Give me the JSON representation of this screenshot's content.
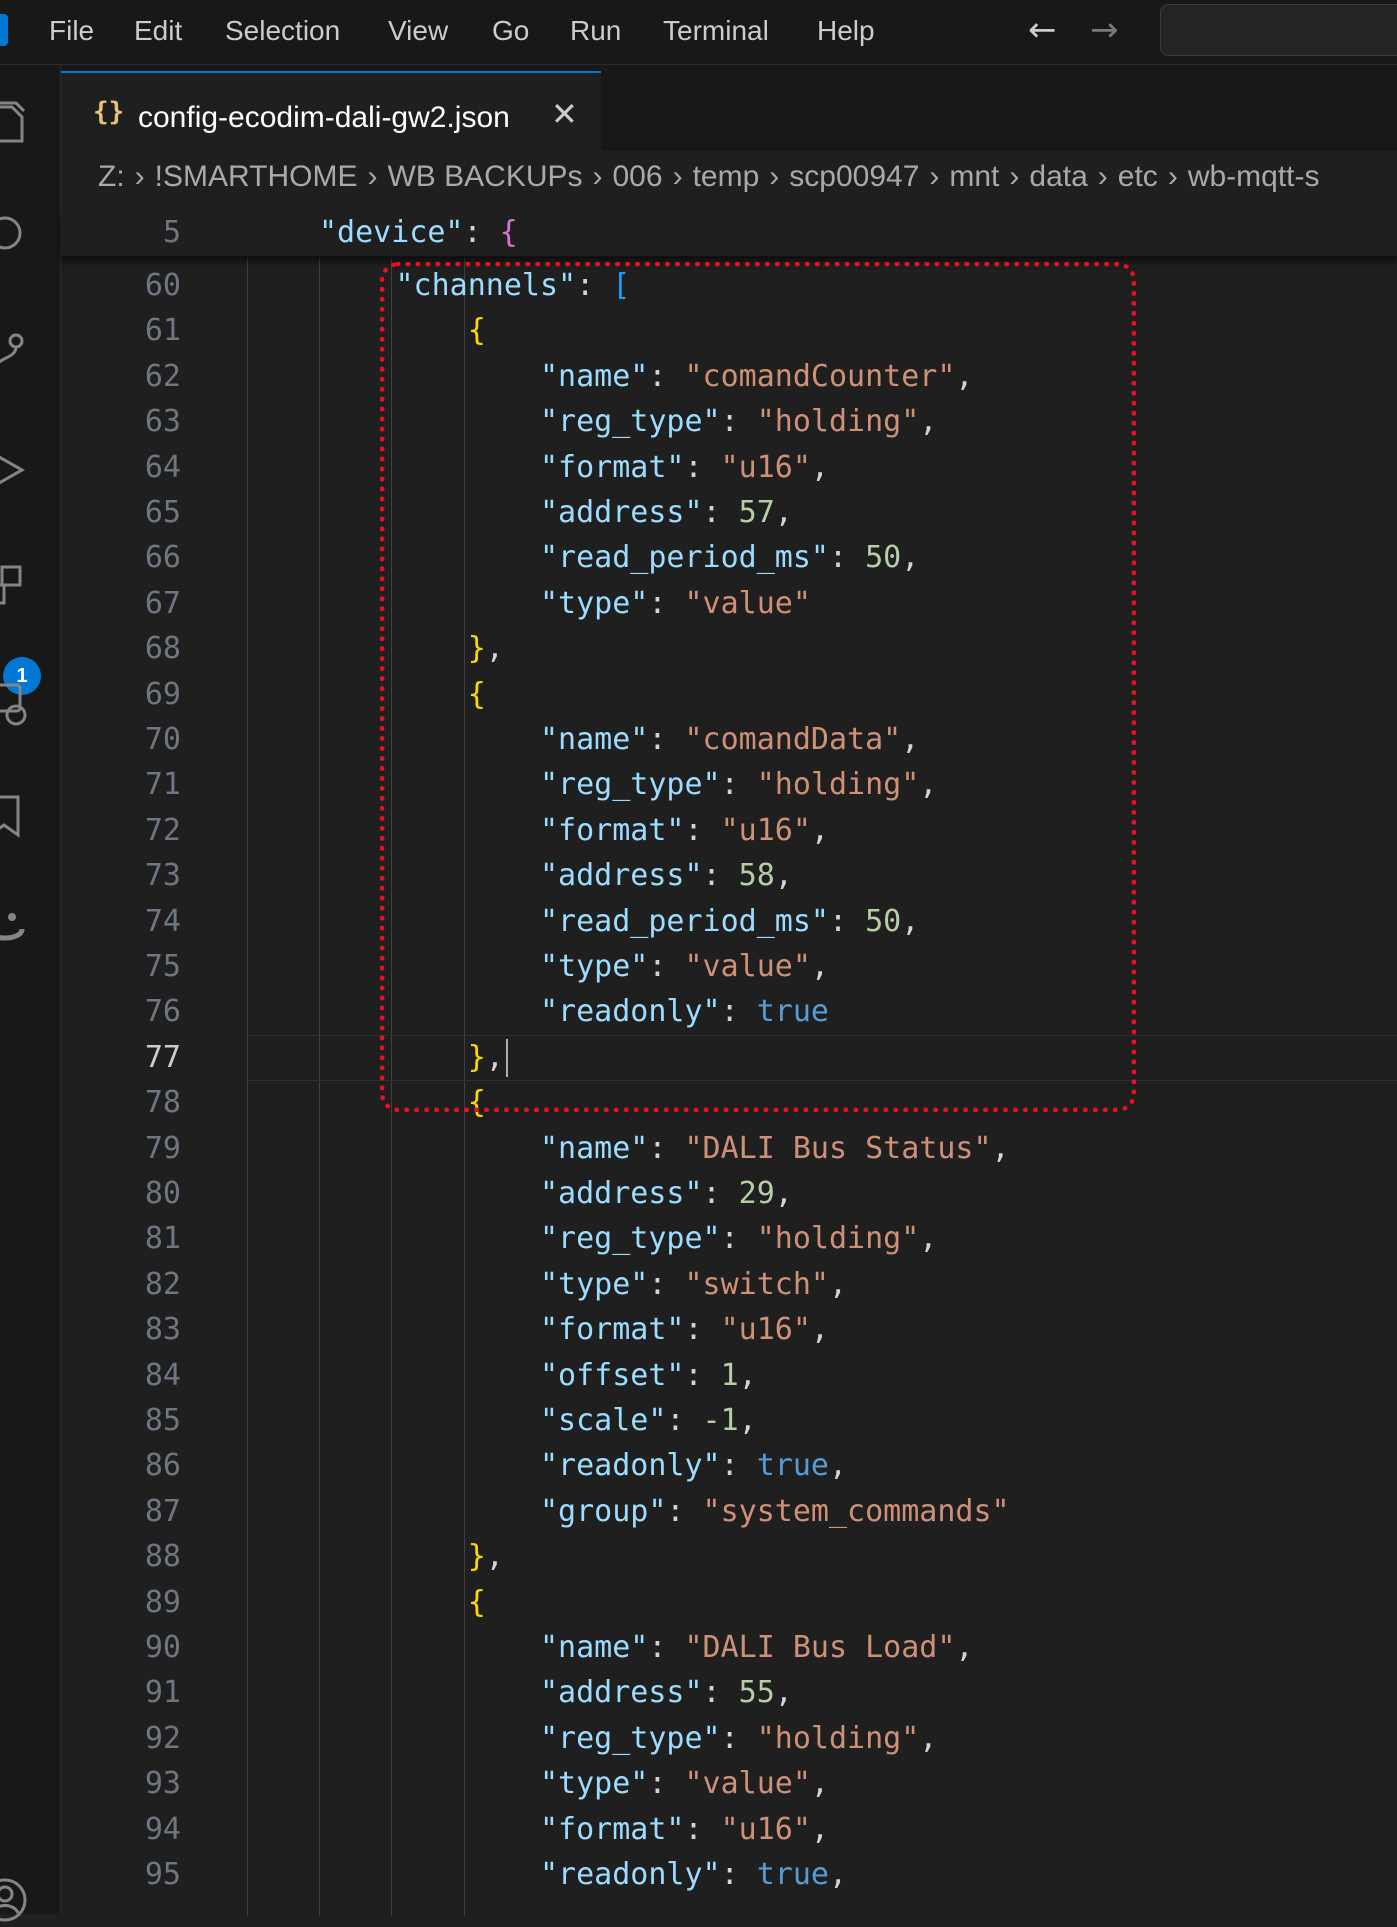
{
  "menu": [
    "File",
    "Edit",
    "Selection",
    "View",
    "Go",
    "Run",
    "Terminal",
    "Help"
  ],
  "nav": {
    "back": "←",
    "forward": "→"
  },
  "activity_bar": {
    "extensions_badge": "1"
  },
  "tab": {
    "icon": "{}",
    "label": "config-ecodim-dali-gw2.json",
    "close": "✕"
  },
  "breadcrumbs": [
    "Z:",
    "!SMARTHOME",
    "WB BACKUPs",
    "006",
    "temp",
    "scp00947",
    "mnt",
    "data",
    "etc",
    "wb-mqtt-s"
  ],
  "sticky": {
    "line": "5",
    "text": "\"device\": {"
  },
  "lines": [
    {
      "n": "60",
      "text": "\"channels\": ["
    },
    {
      "n": "61",
      "text": "{"
    },
    {
      "n": "62",
      "text": "\"name\": \"comandCounter\","
    },
    {
      "n": "63",
      "text": "\"reg_type\": \"holding\","
    },
    {
      "n": "64",
      "text": "\"format\": \"u16\","
    },
    {
      "n": "65",
      "text": "\"address\": 57,"
    },
    {
      "n": "66",
      "text": "\"read_period_ms\": 50,"
    },
    {
      "n": "67",
      "text": "\"type\": \"value\""
    },
    {
      "n": "68",
      "text": "},"
    },
    {
      "n": "69",
      "text": "{"
    },
    {
      "n": "70",
      "text": "\"name\": \"comandData\","
    },
    {
      "n": "71",
      "text": "\"reg_type\": \"holding\","
    },
    {
      "n": "72",
      "text": "\"format\": \"u16\","
    },
    {
      "n": "73",
      "text": "\"address\": 58,"
    },
    {
      "n": "74",
      "text": "\"read_period_ms\": 50,"
    },
    {
      "n": "75",
      "text": "\"type\": \"value\","
    },
    {
      "n": "76",
      "text": "\"readonly\": true"
    },
    {
      "n": "77",
      "text": "},"
    },
    {
      "n": "78",
      "text": "{"
    },
    {
      "n": "79",
      "text": "\"name\": \"DALI Bus Status\","
    },
    {
      "n": "80",
      "text": "\"address\": 29,"
    },
    {
      "n": "81",
      "text": "\"reg_type\": \"holding\","
    },
    {
      "n": "82",
      "text": "\"type\": \"switch\","
    },
    {
      "n": "83",
      "text": "\"format\": \"u16\","
    },
    {
      "n": "84",
      "text": "\"offset\": 1,"
    },
    {
      "n": "85",
      "text": "\"scale\": -1,"
    },
    {
      "n": "86",
      "text": "\"readonly\": true,"
    },
    {
      "n": "87",
      "text": "\"group\": \"system_commands\""
    },
    {
      "n": "88",
      "text": "},"
    },
    {
      "n": "89",
      "text": "{"
    },
    {
      "n": "90",
      "text": "\"name\": \"DALI Bus Load\","
    },
    {
      "n": "91",
      "text": "\"address\": 55,"
    },
    {
      "n": "92",
      "text": "\"reg_type\": \"holding\","
    },
    {
      "n": "93",
      "text": "\"type\": \"value\","
    },
    {
      "n": "94",
      "text": "\"format\": \"u16\","
    },
    {
      "n": "95",
      "text": "\"readonly\": true,"
    }
  ],
  "current_line": "77",
  "colors": {
    "annotation": "#e81123",
    "accent": "#0078d4"
  }
}
